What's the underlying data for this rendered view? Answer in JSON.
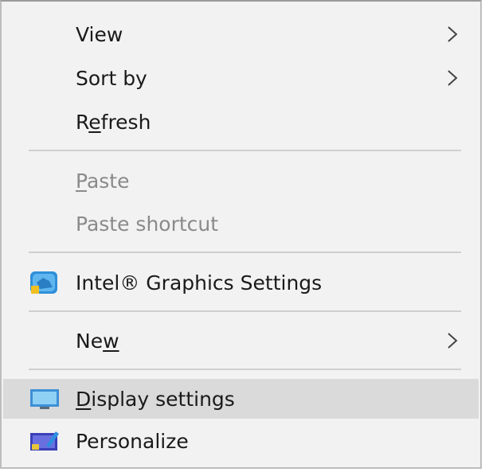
{
  "menu": {
    "items": [
      {
        "label": "View",
        "has_submenu": true,
        "enabled": true
      },
      {
        "label": "Sort by",
        "has_submenu": true,
        "enabled": true
      },
      {
        "label_parts": [
          "R",
          "e",
          "fresh"
        ],
        "has_submenu": false,
        "enabled": true
      },
      {
        "label_parts": [
          "",
          "P",
          "aste"
        ],
        "has_submenu": false,
        "enabled": false
      },
      {
        "label": "Paste shortcut",
        "has_submenu": false,
        "enabled": false
      },
      {
        "label": "Intel® Graphics Settings",
        "icon": "intel-graphics-icon",
        "has_submenu": false,
        "enabled": true
      },
      {
        "label_parts": [
          "Ne",
          "w",
          ""
        ],
        "has_submenu": true,
        "enabled": true
      },
      {
        "label_parts": [
          "",
          "D",
          "isplay settings"
        ],
        "icon": "display-settings-icon",
        "has_submenu": false,
        "enabled": true,
        "highlighted": true
      },
      {
        "label": "Personalize",
        "icon": "personalize-icon",
        "has_submenu": false,
        "enabled": true
      }
    ]
  },
  "colors": {
    "menu_background": "#f2f2f2",
    "highlight": "#dadada",
    "text": "#1a1a1a",
    "disabled_text": "#8a8a8a",
    "separator": "#cfcfcf"
  }
}
